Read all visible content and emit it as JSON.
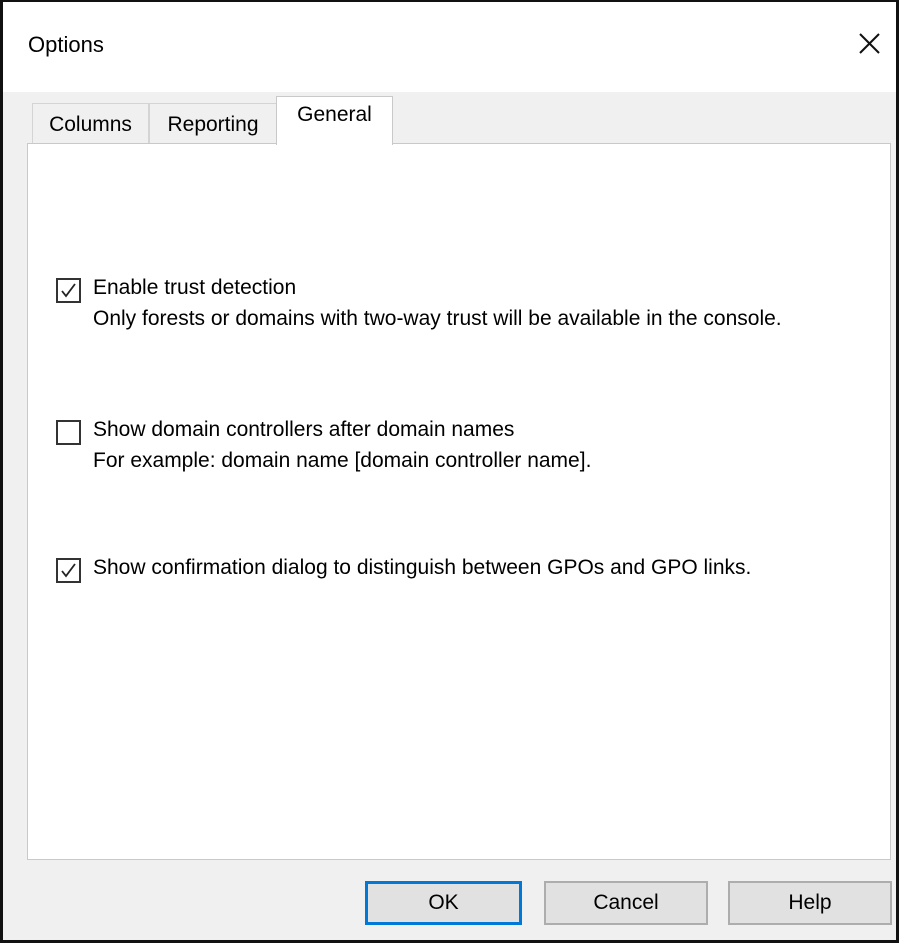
{
  "window": {
    "title": "Options",
    "close_icon": "close-icon"
  },
  "tabs": [
    {
      "label": "Columns",
      "selected": false
    },
    {
      "label": "Reporting",
      "selected": false
    },
    {
      "label": "General",
      "selected": true
    }
  ],
  "general": {
    "options": [
      {
        "label": "Enable trust detection",
        "description": "Only forests or domains with two-way trust will be available in the console.",
        "checked": true
      },
      {
        "label": "Show domain controllers after domain names",
        "description": "For example: domain name [domain controller name].",
        "checked": false
      },
      {
        "label": "Show confirmation dialog to distinguish between GPOs and GPO links.",
        "description": "",
        "checked": true
      }
    ]
  },
  "buttons": {
    "ok": "OK",
    "cancel": "Cancel",
    "help": "Help"
  },
  "colors": {
    "accent": "#0078d7",
    "window_background": "#f0f0f0",
    "panel_background": "#ffffff"
  }
}
